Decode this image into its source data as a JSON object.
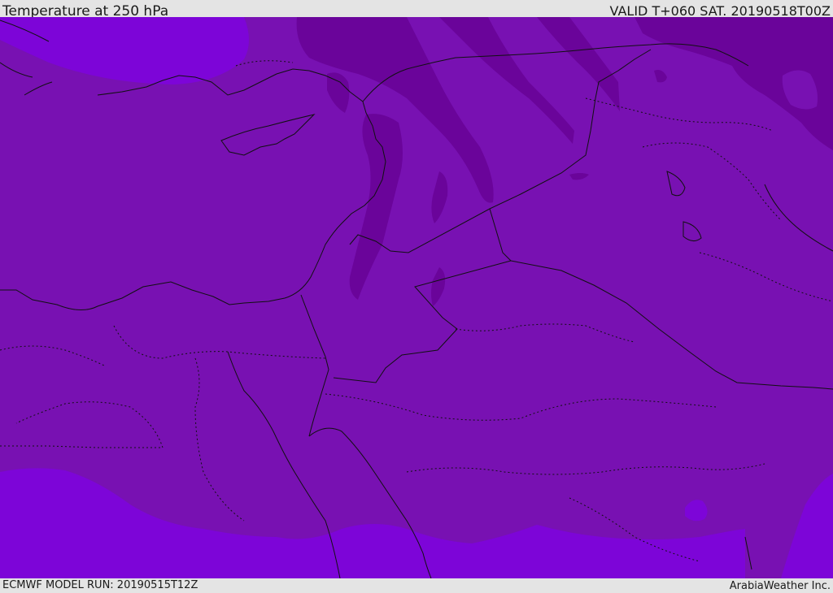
{
  "header": {
    "title": "Temperature at 250 hPa",
    "valid": "VALID T+060 SAT. 20190518T00Z"
  },
  "footer": {
    "model_run": "ECMWF MODEL RUN: 20190515T12Z",
    "credit": "ArabiaWeather Inc."
  },
  "map": {
    "colors": {
      "base": "#7811b2",
      "warm_band": "#7d05d8",
      "cold_band": "#6a049a",
      "boundary": "#111111"
    }
  }
}
